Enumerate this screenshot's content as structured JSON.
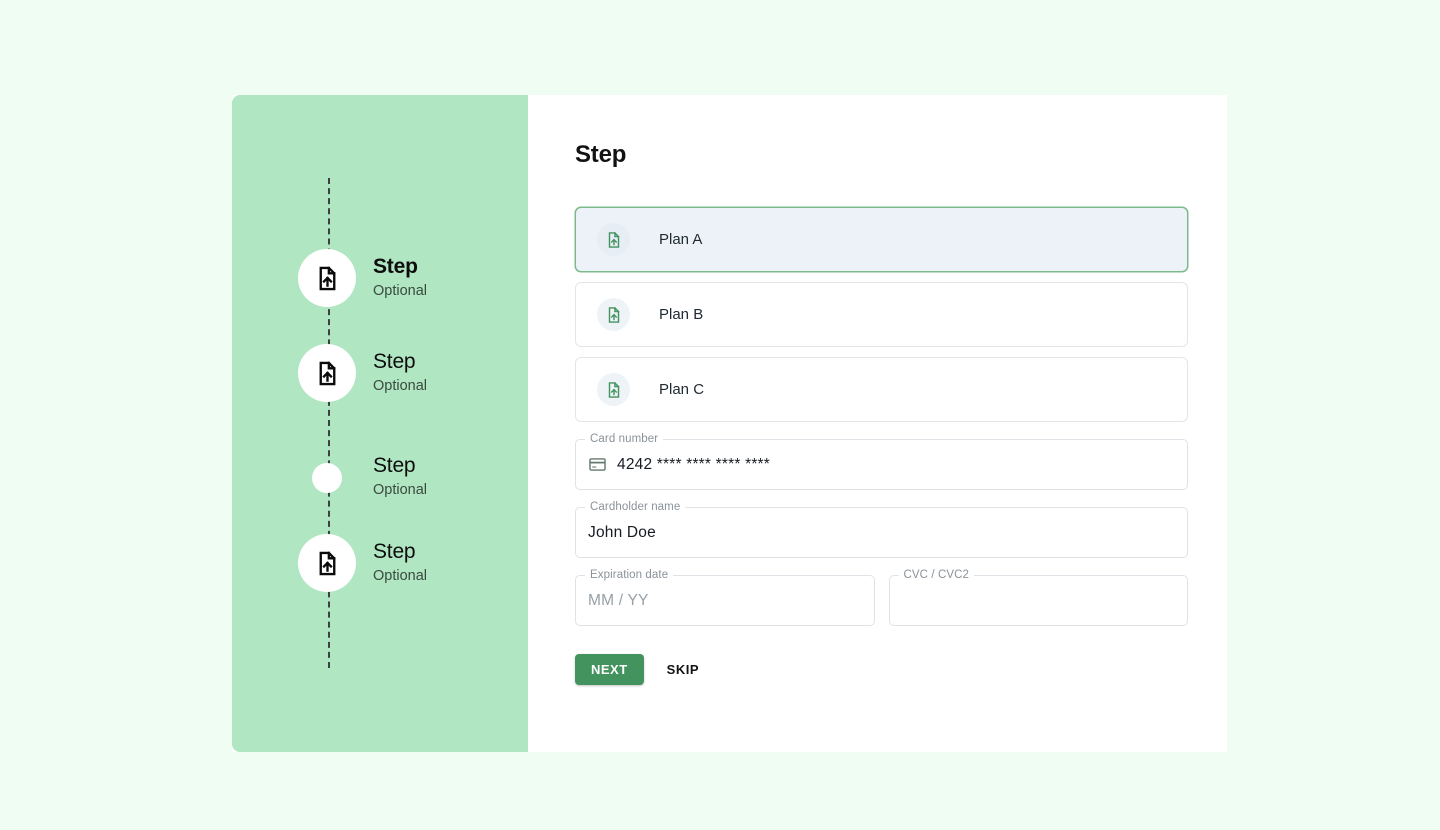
{
  "theme": {
    "page_background": "#effdf2",
    "sidebar_background": "#b0e6c1",
    "panel_background": "#ffffff",
    "accent_green": "#43935f",
    "selected_card_background": "#edf2f8",
    "selected_card_border": "#7cba8d",
    "icon_green": "#43935f"
  },
  "stepper": {
    "connector_style": "dashed",
    "steps": [
      {
        "title": "Step",
        "subtitle": "Optional",
        "icon": "file-upload-icon",
        "state": "active",
        "has_icon": true
      },
      {
        "title": "Step",
        "subtitle": "Optional",
        "icon": "file-upload-icon",
        "state": "default",
        "has_icon": true
      },
      {
        "title": "Step",
        "subtitle": "Optional",
        "icon": "",
        "state": "empty",
        "has_icon": false
      },
      {
        "title": "Step",
        "subtitle": "Optional",
        "icon": "file-upload-icon",
        "state": "default",
        "has_icon": true
      }
    ]
  },
  "main": {
    "title": "Step",
    "plans": [
      {
        "label": "Plan A",
        "icon": "file-upload-icon",
        "selected": true
      },
      {
        "label": "Plan B",
        "icon": "file-upload-icon",
        "selected": false
      },
      {
        "label": "Plan C",
        "icon": "file-upload-icon",
        "selected": false
      }
    ],
    "fields": {
      "card_number": {
        "label": "Card number",
        "value": "4242 **** **** **** ****",
        "placeholder": "",
        "icon": "credit-card-icon"
      },
      "cardholder_name": {
        "label": "Cardholder name",
        "value": "John Doe",
        "placeholder": ""
      },
      "expiration_date": {
        "label": "Expiration date",
        "value": "",
        "placeholder": "MM / YY"
      },
      "cvc": {
        "label": "CVC / CVC2",
        "value": "",
        "placeholder": ""
      }
    },
    "actions": {
      "next_label": "NEXT",
      "skip_label": "SKIP"
    }
  }
}
